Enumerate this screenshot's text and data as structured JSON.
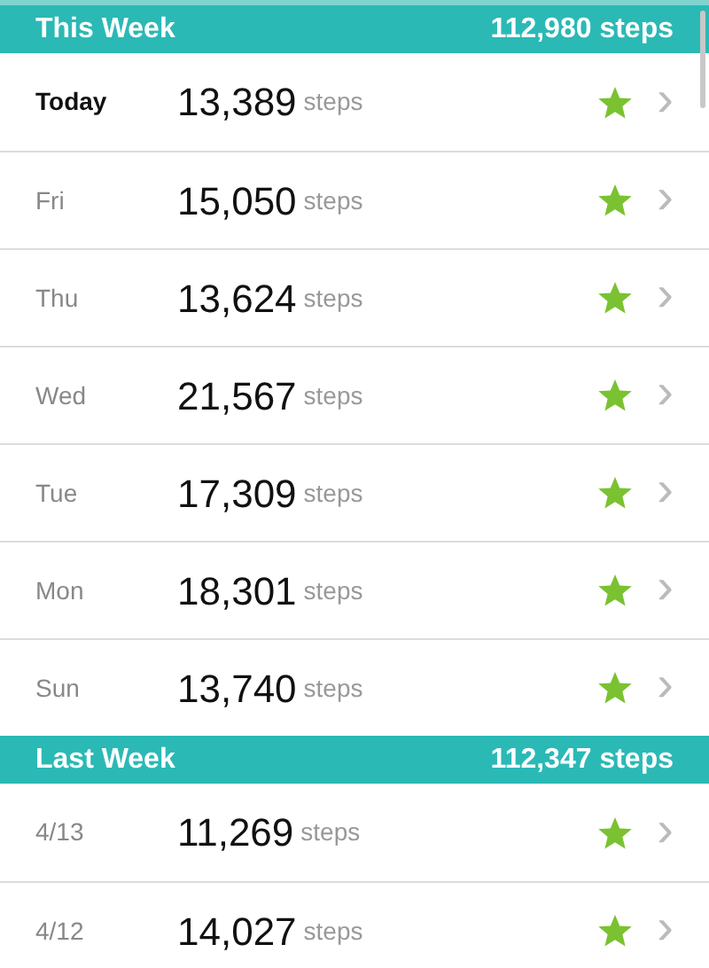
{
  "sections": [
    {
      "title": "This Week",
      "total": "112,980 steps",
      "days": [
        {
          "day": "Today",
          "current": true,
          "steps": "13,389",
          "unit": "steps",
          "goal_met": true,
          "chevron": "›"
        },
        {
          "day": "Fri",
          "current": false,
          "steps": "15,050",
          "unit": "steps",
          "goal_met": true,
          "chevron": "›"
        },
        {
          "day": "Thu",
          "current": false,
          "steps": "13,624",
          "unit": "steps",
          "goal_met": true,
          "chevron": "›"
        },
        {
          "day": "Wed",
          "current": false,
          "steps": "21,567",
          "unit": "steps",
          "goal_met": true,
          "chevron": "›"
        },
        {
          "day": "Tue",
          "current": false,
          "steps": "17,309",
          "unit": "steps",
          "goal_met": true,
          "chevron": "›"
        },
        {
          "day": "Mon",
          "current": false,
          "steps": "18,301",
          "unit": "steps",
          "goal_met": true,
          "chevron": "›"
        },
        {
          "day": "Sun",
          "current": false,
          "steps": "13,740",
          "unit": "steps",
          "goal_met": true,
          "chevron": "›"
        }
      ]
    },
    {
      "title": "Last Week",
      "total": "112,347 steps",
      "days": [
        {
          "day": "4/13",
          "current": false,
          "steps": "11,269",
          "unit": "steps",
          "goal_met": true,
          "chevron": "›"
        },
        {
          "day": "4/12",
          "current": false,
          "steps": "14,027",
          "unit": "steps",
          "goal_met": true,
          "chevron": "›"
        }
      ]
    }
  ]
}
